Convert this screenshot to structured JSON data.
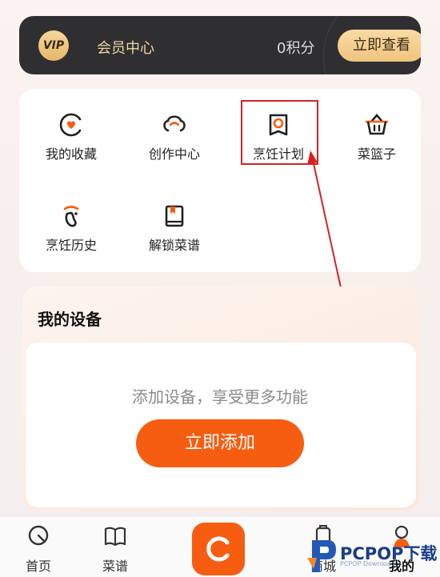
{
  "vip": {
    "badge": "VIP",
    "title": "会员中心",
    "points": "0积分",
    "view_button": "立即查看"
  },
  "shortcuts": [
    {
      "label": "我的收藏",
      "icon": "heart-circle-icon"
    },
    {
      "label": "创作中心",
      "icon": "chef-hat-icon"
    },
    {
      "label": "烹饪计划",
      "icon": "cooking-plan-icon"
    },
    {
      "label": "菜篮子",
      "icon": "basket-icon"
    },
    {
      "label": "烹饪历史",
      "icon": "footprint-icon"
    },
    {
      "label": "解锁菜谱",
      "icon": "unlock-recipe-icon"
    }
  ],
  "devices": {
    "title": "我的设备",
    "hint": "添加设备，享受更多功能",
    "add_button": "立即添加"
  },
  "nav": [
    {
      "label": "首页",
      "icon": "home-icon"
    },
    {
      "label": "菜谱",
      "icon": "recipe-book-icon"
    },
    {
      "label": "",
      "icon": "center-logo-icon"
    },
    {
      "label": "商城",
      "icon": "shop-icon"
    },
    {
      "label": "我的",
      "icon": "profile-icon"
    }
  ],
  "watermark": {
    "text": "PCPOP下载",
    "sub": "PCPOP Download"
  },
  "colors": {
    "accent": "#f75d10",
    "vip_bg": "#2f2f31",
    "gold": "#f0c47f",
    "annotation": "#d32323"
  }
}
